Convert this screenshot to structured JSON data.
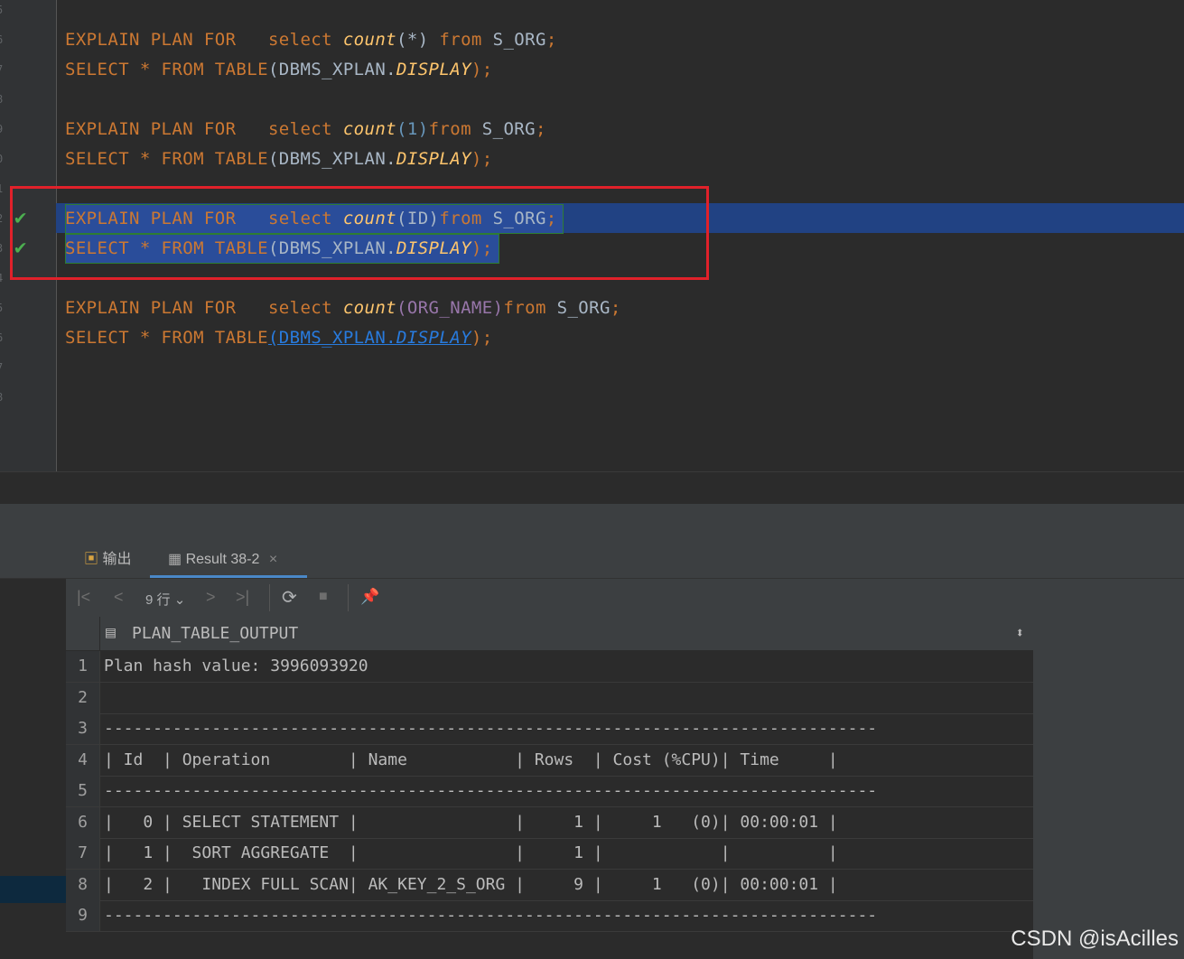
{
  "editor": {
    "lines": [
      {
        "kind": "explain",
        "p1": "EXPLAIN PLAN FOR   select ",
        "fn": "count",
        "arg": "(*)",
        "p2": " from ",
        "tbl": "S_ORG",
        "end": ";"
      },
      {
        "kind": "select",
        "p1": "SELECT * FROM TABLE",
        "p2": "(DBMS_XPLAN.",
        "fn": "DISPLAY",
        "end": ");"
      },
      {
        "kind": "explain",
        "p1": "EXPLAIN PLAN FOR   select ",
        "fn": "count",
        "arg": "(1)",
        "p2": "from ",
        "tbl": "S_ORG",
        "end": ";"
      },
      {
        "kind": "select",
        "p1": "SELECT * FROM TABLE",
        "p2": "(DBMS_XPLAN.",
        "fn": "DISPLAY",
        "end": ");"
      },
      {
        "kind": "explain",
        "p1": "EXPLAIN PLAN FOR   select ",
        "fn": "count",
        "arg": "(ID)",
        "p2": "from ",
        "tbl": "S_ORG",
        "end": ";"
      },
      {
        "kind": "select",
        "p1": "SELECT * FROM TABLE",
        "p2": "(DBMS_XPLAN.",
        "fn": "DISPLAY",
        "end": ");"
      },
      {
        "kind": "explain",
        "p1": "EXPLAIN PLAN FOR   select ",
        "fn": "count",
        "arg": "(ORG_NAME)",
        "p2": "from ",
        "tbl": "S_ORG",
        "end": ";"
      },
      {
        "kind": "select",
        "p1": "SELECT * FROM TABLE",
        "p2": "(DBMS_XPLAN.",
        "fn": "DISPLAY",
        "end": ");"
      }
    ],
    "gutter_numbers": [
      "5",
      "6",
      "7",
      "8",
      "9",
      "0",
      "1",
      "2",
      "3",
      "4",
      "5",
      "6",
      "7",
      "8"
    ],
    "check_glyph": "✔"
  },
  "tabs": {
    "output": "输出",
    "result": "Result 38-2",
    "close": "×"
  },
  "toolbar": {
    "first": "|<",
    "prev": "<",
    "rows": "9 行",
    "next": ">",
    "last": ">|",
    "refresh": "⟳",
    "stop": "■",
    "pin": "📌"
  },
  "grid": {
    "column": "PLAN_TABLE_OUTPUT",
    "sort_glyph": "⬍",
    "rows": [
      {
        "n": "1",
        "text": "Plan hash value: 3996093920"
      },
      {
        "n": "2",
        "text": ""
      },
      {
        "n": "3",
        "text": "-------------------------------------------------------------------------------"
      },
      {
        "n": "4",
        "text": "| Id  | Operation        | Name           | Rows  | Cost (%CPU)| Time     |"
      },
      {
        "n": "5",
        "text": "-------------------------------------------------------------------------------"
      },
      {
        "n": "6",
        "text": "|   0 | SELECT STATEMENT |                |     1 |     1   (0)| 00:00:01 |"
      },
      {
        "n": "7",
        "text": "|   1 |  SORT AGGREGATE  |                |     1 |            |          |"
      },
      {
        "n": "8",
        "text": "|   2 |   INDEX FULL SCAN| AK_KEY_2_S_ORG |     9 |     1   (0)| 00:00:01 |"
      },
      {
        "n": "9",
        "text": "-------------------------------------------------------------------------------"
      }
    ]
  },
  "watermark": "CSDN @isAcilles",
  "colors": {
    "keyword": "#cc7832",
    "function": "#ffc66d",
    "number": "#6897bb",
    "column": "#9876aa",
    "selection": "#214283",
    "redbox": "#e0212a",
    "check": "#4caf50"
  }
}
